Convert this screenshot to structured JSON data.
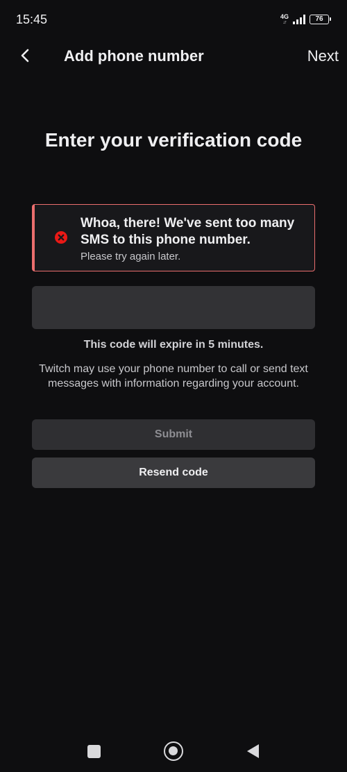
{
  "status_bar": {
    "time": "15:45",
    "network_type": "4G",
    "network_arrows": "↓↑",
    "battery": "76"
  },
  "header": {
    "title": "Add phone number",
    "next_label": "Next",
    "back_icon": "chevron-left-icon"
  },
  "main": {
    "heading": "Enter your verification code",
    "error": {
      "title": "Whoa, there! We've sent too many SMS to this phone number.",
      "subtitle": "Please try again later.",
      "icon": "error-circle-icon",
      "color": "#eb6e6e"
    },
    "code_input": {
      "value": "",
      "placeholder": ""
    },
    "expire_text": "This code will expire in 5 minutes.",
    "info_text": "Twitch may use your phone number to call or send text messages with information regarding your account.",
    "submit_label": "Submit",
    "resend_label": "Resend code"
  },
  "nav_bar": {
    "recents_icon": "square-icon",
    "home_icon": "circle-home-icon",
    "back_icon": "triangle-back-icon"
  }
}
